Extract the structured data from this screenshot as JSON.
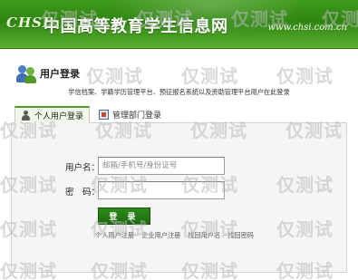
{
  "header": {
    "logo_text": "CHSI",
    "site_title": "中国高等教育学生信息网",
    "site_url": "www.chsi.com.cn"
  },
  "section": {
    "title": "用户登录",
    "subtitle": "学信档案、学籍学历管理平台、预征报名系统以及资助管理平台用户在此登录"
  },
  "tabs": [
    {
      "label": "个人用户登录",
      "active": true,
      "icon": "person-icon"
    },
    {
      "label": "管理部门登录",
      "active": false,
      "icon": "admin-icon"
    }
  ],
  "form": {
    "username_label": "用户名：",
    "username_placeholder": "邮箱/手机号/身份证号",
    "username_value": "",
    "password_label": "密　码：",
    "password_value": "",
    "login_button": "登 录"
  },
  "links": [
    "个人用户注册",
    "企业用户注册",
    "找回用户名",
    "找回密码"
  ],
  "watermark": {
    "text": "仅测试"
  },
  "colors": {
    "brand_green": "#2f8510",
    "button_green": "#1e6a0e",
    "panel_bg": "#f5f5f5"
  }
}
